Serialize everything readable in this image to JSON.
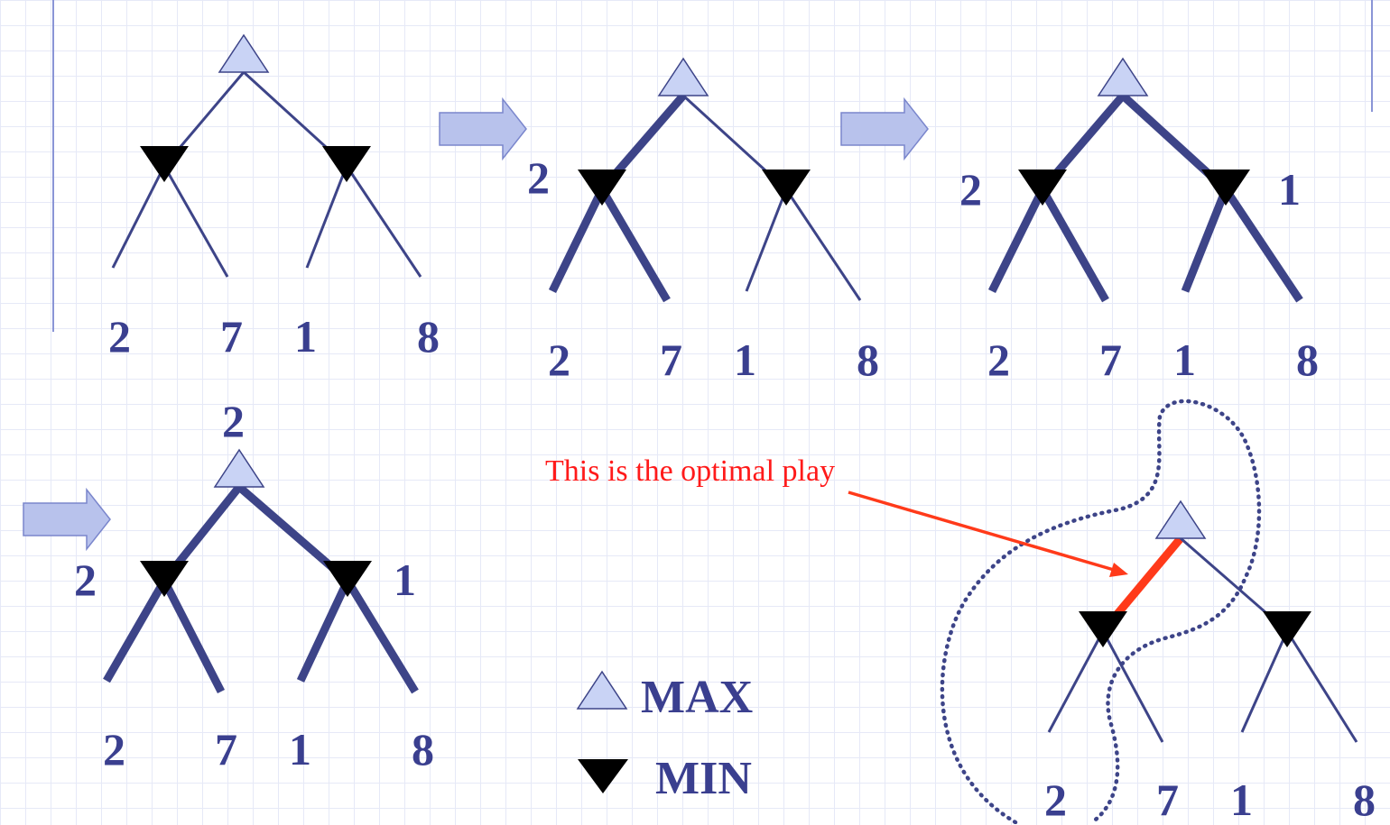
{
  "colors": {
    "edge": "#3d4488",
    "max_fill": "#c9d3f5",
    "max_stroke": "#3d4488",
    "min_fill": "#000000",
    "arrow_fill": "#b8c2ec",
    "arrow_stroke": "#7a86cc",
    "highlight_edge": "#ff3a1a",
    "caption": "#ff1a1a",
    "dotted_outline": "#3d4488"
  },
  "leaf_values": [
    "2",
    "7",
    "1",
    "8"
  ],
  "panels": [
    {
      "id": "panel-1",
      "min_values": [
        "",
        ""
      ],
      "root_value": ""
    },
    {
      "id": "panel-2",
      "min_values": [
        "2",
        ""
      ],
      "root_value": ""
    },
    {
      "id": "panel-3",
      "min_values": [
        "2",
        "1"
      ],
      "root_value": ""
    },
    {
      "id": "panel-4",
      "min_values": [
        "2",
        "1"
      ],
      "root_value": "2"
    },
    {
      "id": "panel-5",
      "min_values": [
        "",
        ""
      ],
      "root_value": ""
    }
  ],
  "annotation": {
    "caption": "This is the optimal  play"
  },
  "legend": {
    "max_label": "MAX",
    "min_label": "MIN"
  }
}
